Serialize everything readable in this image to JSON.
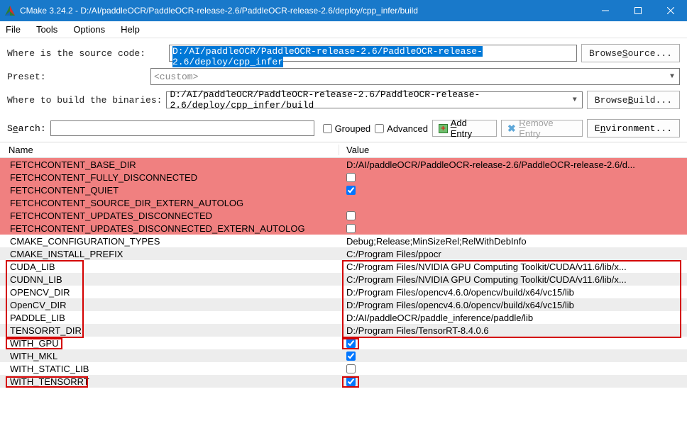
{
  "window": {
    "title": "CMake 3.24.2 - D:/AI/paddleOCR/PaddleOCR-release-2.6/PaddleOCR-release-2.6/deploy/cpp_infer/build"
  },
  "menu": {
    "file": "File",
    "tools": "Tools",
    "options": "Options",
    "help": "Help"
  },
  "form": {
    "source_label": "Where is the source code:",
    "source_value": "D:/AI/paddleOCR/PaddleOCR-release-2.6/PaddleOCR-release-2.6/deploy/cpp_infer",
    "browse_source_prefix": "Browse ",
    "browse_source_u": "S",
    "browse_source_suffix": "ource...",
    "preset_label": "Preset:",
    "preset_value": "<custom>",
    "build_label": "Where to build the binaries:",
    "build_value": "D:/AI/paddleOCR/PaddleOCR-release-2.6/PaddleOCR-release-2.6/deploy/cpp_infer/build",
    "browse_build_prefix": "Browse ",
    "browse_build_u": "B",
    "browse_build_suffix": "uild..."
  },
  "toolbar": {
    "search_label_pre": "S",
    "search_label_u": "e",
    "search_label_post": "arch:",
    "grouped": "Grouped",
    "advanced": "Advanced",
    "add_entry_u": "A",
    "add_entry_rest": "dd Entry",
    "remove_entry_u": "R",
    "remove_entry_rest": "emove Entry",
    "env_pre": "E",
    "env_u": "n",
    "env_post": "vironment..."
  },
  "table": {
    "headers": {
      "name": "Name",
      "value": "Value"
    },
    "rows": [
      {
        "name": "FETCHCONTENT_BASE_DIR",
        "value": "D:/AI/paddleOCR/PaddleOCR-release-2.6/PaddleOCR-release-2.6/d...",
        "type": "text",
        "highlight": "red"
      },
      {
        "name": "FETCHCONTENT_FULLY_DISCONNECTED",
        "value": "",
        "type": "check",
        "checked": false,
        "highlight": "red"
      },
      {
        "name": "FETCHCONTENT_QUIET",
        "value": "",
        "type": "check",
        "checked": true,
        "highlight": "red"
      },
      {
        "name": "FETCHCONTENT_SOURCE_DIR_EXTERN_AUTOLOG",
        "value": "",
        "type": "text",
        "highlight": "red"
      },
      {
        "name": "FETCHCONTENT_UPDATES_DISCONNECTED",
        "value": "",
        "type": "check",
        "checked": false,
        "highlight": "red"
      },
      {
        "name": "FETCHCONTENT_UPDATES_DISCONNECTED_EXTERN_AUTOLOG",
        "value": "",
        "type": "check",
        "checked": false,
        "highlight": "red"
      },
      {
        "name": "CMAKE_CONFIGURATION_TYPES",
        "value": "Debug;Release;MinSizeRel;RelWithDebInfo",
        "type": "text",
        "alt": 0
      },
      {
        "name": "CMAKE_INSTALL_PREFIX",
        "value": "C:/Program Files/ppocr",
        "type": "text",
        "alt": 1
      },
      {
        "name": "CUDA_LIB",
        "value": "C:/Program Files/NVIDIA GPU Computing Toolkit/CUDA/v11.6/lib/x...",
        "type": "text",
        "alt": 0
      },
      {
        "name": "CUDNN_LIB",
        "value": "C:/Program Files/NVIDIA GPU Computing Toolkit/CUDA/v11.6/lib/x...",
        "type": "text",
        "alt": 1
      },
      {
        "name": "OPENCV_DIR",
        "value": "D:/Program Files/opencv4.6.0/opencv/build/x64/vc15/lib",
        "type": "text",
        "alt": 0
      },
      {
        "name": "OpenCV_DIR",
        "value": "D:/Program Files/opencv4.6.0/opencv/build/x64/vc15/lib",
        "type": "text",
        "alt": 1
      },
      {
        "name": "PADDLE_LIB",
        "value": "D:/AI/paddleOCR/paddle_inference/paddle/lib",
        "type": "text",
        "alt": 0
      },
      {
        "name": "TENSORRT_DIR",
        "value": "D:/Program Files/TensorRT-8.4.0.6",
        "type": "text",
        "alt": 1
      },
      {
        "name": "WITH_GPU",
        "value": "",
        "type": "check",
        "checked": true,
        "alt": 0
      },
      {
        "name": "WITH_MKL",
        "value": "",
        "type": "check",
        "checked": true,
        "alt": 1
      },
      {
        "name": "WITH_STATIC_LIB",
        "value": "",
        "type": "check",
        "checked": false,
        "alt": 0
      },
      {
        "name": "WITH_TENSORRT",
        "value": "",
        "type": "check",
        "checked": true,
        "alt": 1
      }
    ]
  }
}
